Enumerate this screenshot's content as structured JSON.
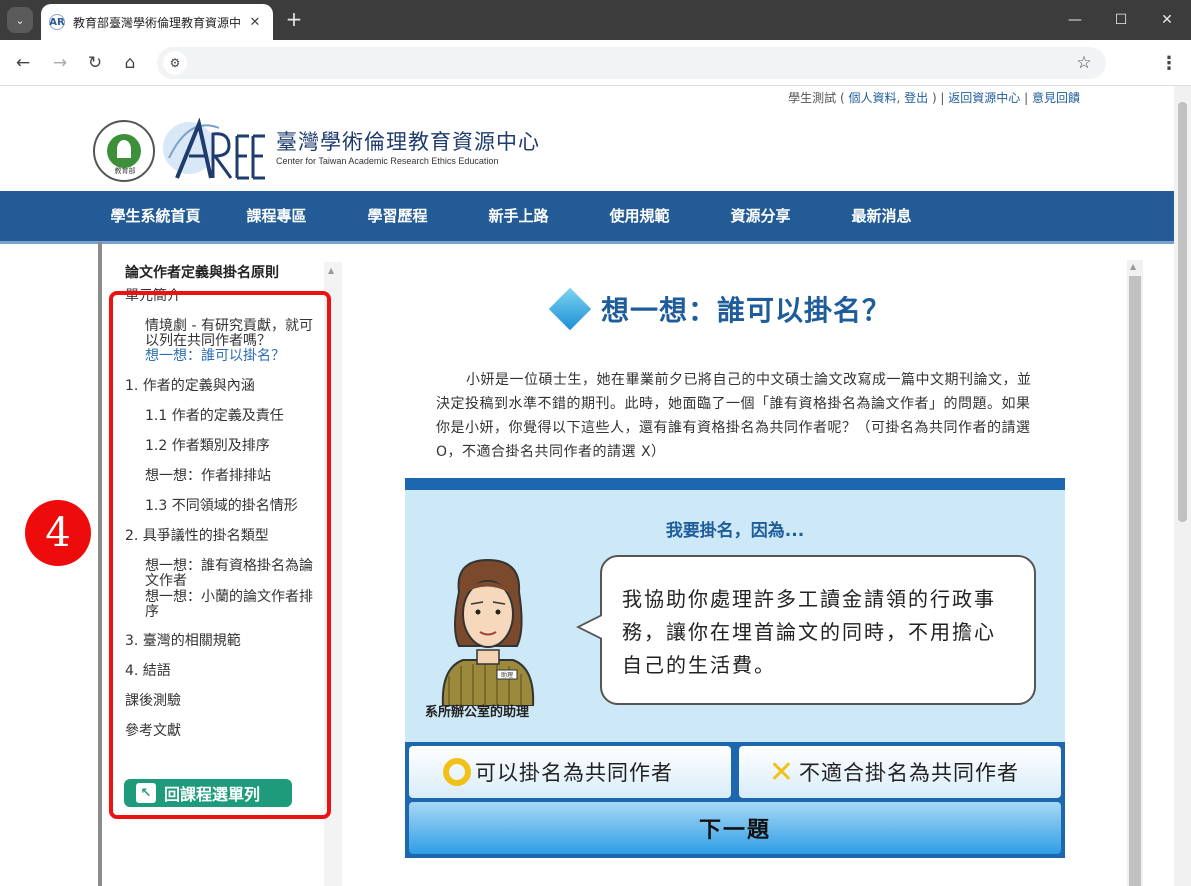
{
  "browser": {
    "tab_title": "教育部臺灣學術倫理教育資源中",
    "favicon_text": "AR",
    "new_tab": "+",
    "close": "✕",
    "tab_list": "⌄",
    "minimize": "—",
    "maximize": "☐",
    "window_close": "✕",
    "back": "←",
    "forward": "→",
    "reload": "↻",
    "home": "⌂",
    "site_info": "⚙",
    "bookmark": "☆",
    "menu": "⋮",
    "url": ""
  },
  "header": {
    "user_prefix": "學生測試 ( ",
    "profile_link": "個人資料",
    "comma": ", ",
    "logout_link": "登出",
    "suffix": " ) | ",
    "back_link": "返回資源中心",
    "sep": " | ",
    "feedback_link": "意見回饋",
    "title": "臺灣學術倫理教育資源中心",
    "subtitle": "Center for Taiwan Academic Research Ethics Education",
    "moe_text": "教育部"
  },
  "nav": {
    "items": [
      "學生系統首頁",
      "課程專區",
      "學習歷程",
      "新手上路",
      "使用規範",
      "資源分享",
      "最新消息"
    ]
  },
  "sidebar": {
    "title": "論文作者定義與掛名原則",
    "items": [
      {
        "label": "單元簡介",
        "level": 1,
        "active": false
      },
      {
        "label": "情境劇 - 有研究貢獻，就可以列在共同作者嗎？",
        "level": 2,
        "active": false
      },
      {
        "label": "想一想：誰可以掛名？",
        "level": 2,
        "active": true
      },
      {
        "label": "1. 作者的定義與內涵",
        "level": 1,
        "active": false
      },
      {
        "label": "1.1 作者的定義及責任",
        "level": 2,
        "active": false
      },
      {
        "label": "1.2 作者類別及排序",
        "level": 2,
        "active": false
      },
      {
        "label": "想一想：作者排排站",
        "level": 2,
        "active": false
      },
      {
        "label": "1.3 不同領域的掛名情形",
        "level": 2,
        "active": false
      },
      {
        "label": "2. 具爭議性的掛名類型",
        "level": 1,
        "active": false
      },
      {
        "label": "想一想：誰有資格掛名為論文作者",
        "level": 2,
        "active": false
      },
      {
        "label": "想一想：小蘭的論文作者排序",
        "level": 2,
        "active": false
      },
      {
        "label": "3. 臺灣的相關規範",
        "level": 1,
        "active": false
      },
      {
        "label": "4. 結語",
        "level": 1,
        "active": false
      },
      {
        "label": "課後測驗",
        "level": 1,
        "active": false
      },
      {
        "label": "參考文獻",
        "level": 1,
        "active": false
      }
    ],
    "back_button": "回課程選單列",
    "back_icon": "↖"
  },
  "annotation": {
    "step_number": "4",
    "color": "#ee1111"
  },
  "content": {
    "title": "想一想：誰可以掛名？",
    "intro": "小妍是一位碩士生，她在畢業前夕已將自己的中文碩士論文改寫成一篇中文期刊論文，並決定投稿到水準不錯的期刊。此時，她面臨了一個「誰有資格掛名為論文作者」的問題。如果你是小妍，你覺得以下這些人，還有誰有資格掛名為共同作者呢？（可掛名為共同作者的請選 O，不適合掛名共同作者的請選 X）",
    "banner": "我要掛名，因為...",
    "speech": "我協助你處理許多工讀金請領的行政事務，讓你在埋首論文的同時，不用擔心自己的生活費。",
    "character": "系所辦公室的助理",
    "badge_text": "助理",
    "option_yes": "可以掛名為共同作者",
    "option_no": "不適合掛名為共同作者",
    "mark_no": "✕",
    "next": "下一題"
  }
}
